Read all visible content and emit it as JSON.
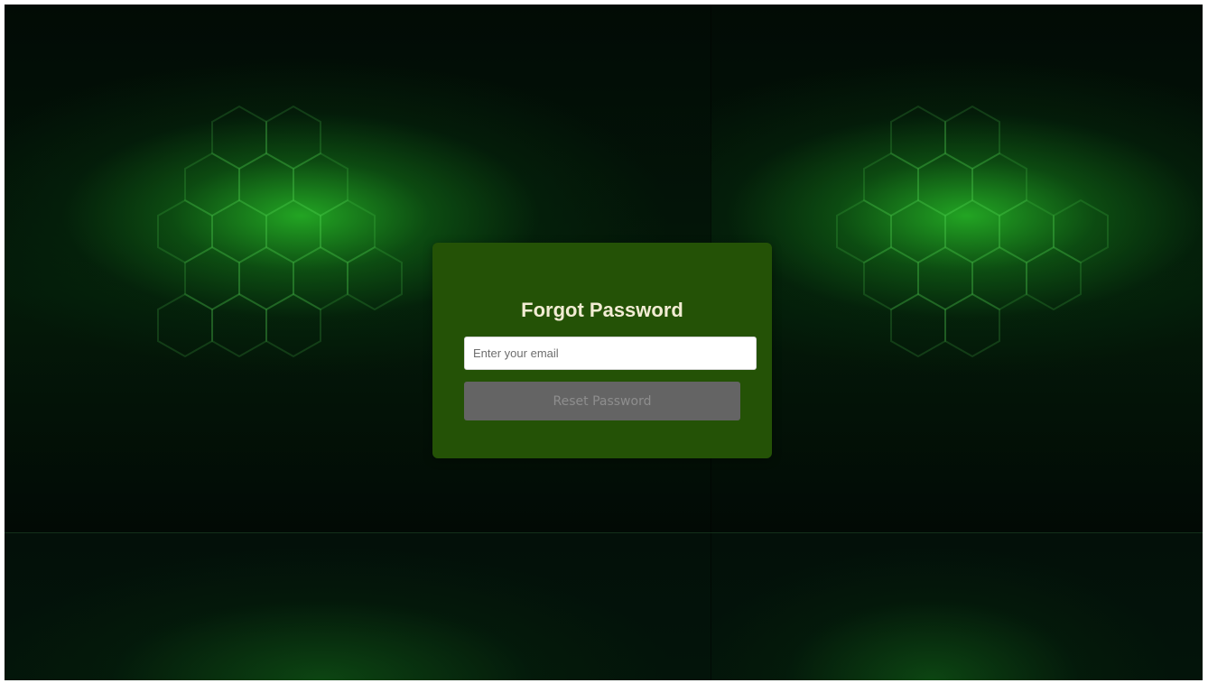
{
  "page": {
    "background_color": "#020a04",
    "accent_glow_color": "#28be28"
  },
  "forgot_password": {
    "title": "Forgot Password",
    "email_placeholder": "Enter your email",
    "email_value": "",
    "reset_button_label": "Reset Password",
    "card_color": "#245206",
    "button_color": "#646464"
  }
}
